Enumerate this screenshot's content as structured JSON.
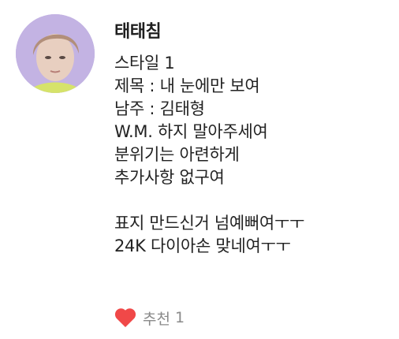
{
  "comment": {
    "username": "태태침",
    "lines": [
      "스타일 1",
      "제목 : 내 눈에만 보여",
      "남주 : 김태형",
      "W.M. 하지 말아주세여",
      "분위기는 아련하게",
      "추가사항 없구여",
      "",
      "표지 만드신거 넘예뻐여ㅜㅜ",
      "24K 다이아손 맞네여ㅜㅜ"
    ],
    "like": {
      "icon": "heart-icon",
      "label": "추천",
      "count": "1",
      "color": "#f04848"
    }
  }
}
